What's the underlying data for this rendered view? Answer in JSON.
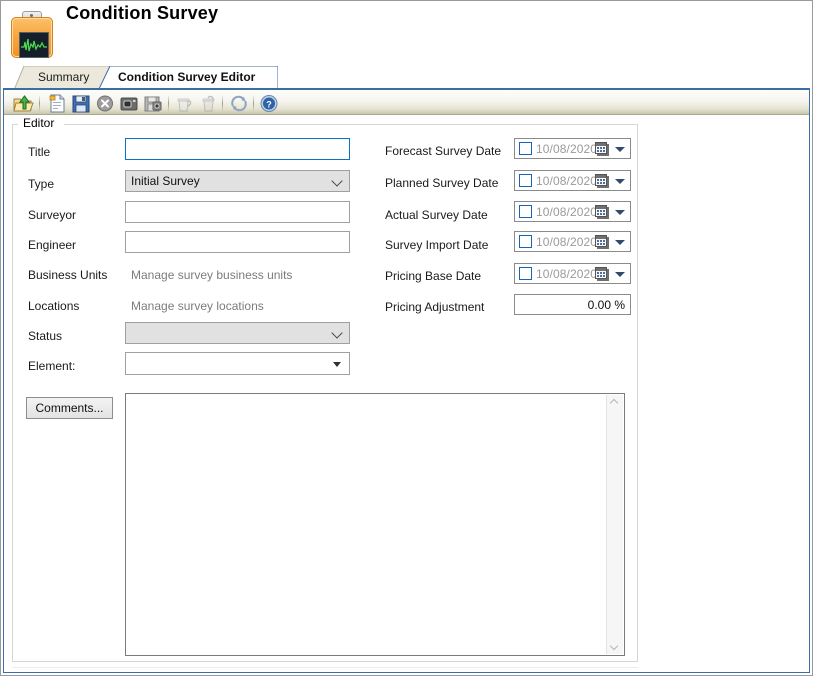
{
  "window": {
    "title": "Condition Survey",
    "app_icon": "clipboard-waveform-icon"
  },
  "tabs": [
    {
      "label": "Summary",
      "active": false,
      "name": "tab-summary"
    },
    {
      "label": "Condition Survey Editor",
      "active": true,
      "name": "tab-condition-survey-editor"
    }
  ],
  "toolbar": {
    "buttons": [
      {
        "name": "open-folder-icon",
        "title": "Open",
        "enabled": true
      },
      {
        "name": "new-document-icon",
        "title": "New",
        "enabled": true
      },
      {
        "name": "save-icon",
        "title": "Save",
        "enabled": true
      },
      {
        "name": "cancel-icon",
        "title": "Cancel",
        "enabled": true
      },
      {
        "name": "snapshot-icon",
        "title": "Snapshot",
        "enabled": true
      },
      {
        "name": "save-image-icon",
        "title": "Save Image",
        "enabled": true
      },
      {
        "name": "delete-record-icon",
        "title": "Delete",
        "enabled": false
      },
      {
        "name": "delete-item-icon",
        "title": "Remove",
        "enabled": false
      },
      {
        "name": "refresh-icon",
        "title": "Refresh",
        "enabled": true
      },
      {
        "name": "help-icon",
        "title": "Help",
        "enabled": true
      }
    ]
  },
  "editor": {
    "group_label": "Editor",
    "left_fields": {
      "title": {
        "label": "Title",
        "value": "",
        "placeholder": ""
      },
      "type": {
        "label": "Type",
        "value": "Initial Survey",
        "options": [
          "Initial Survey"
        ]
      },
      "surveyor": {
        "label": "Surveyor",
        "value": "",
        "placeholder": ""
      },
      "engineer": {
        "label": "Engineer",
        "value": "",
        "placeholder": ""
      },
      "business_units": {
        "label": "Business Units",
        "link_text": "Manage survey business units"
      },
      "locations": {
        "label": "Locations",
        "link_text": "Manage survey locations"
      },
      "status": {
        "label": "Status",
        "value": "",
        "options": []
      },
      "element": {
        "label": "Element:",
        "value": "",
        "options": []
      }
    },
    "right_fields": {
      "forecast_survey_date": {
        "label": "Forecast Survey Date",
        "value": "10/08/2020",
        "checked": false
      },
      "planned_survey_date": {
        "label": "Planned Survey Date",
        "value": "10/08/2020",
        "checked": false
      },
      "actual_survey_date": {
        "label": "Actual Survey Date",
        "value": "10/08/2020",
        "checked": false
      },
      "survey_import_date": {
        "label": "Survey Import Date",
        "value": "10/08/2020",
        "checked": false
      },
      "pricing_base_date": {
        "label": "Pricing Base Date",
        "value": "10/08/2020",
        "checked": false
      },
      "pricing_adjustment": {
        "label": "Pricing Adjustment",
        "value": "0.00 %"
      }
    },
    "comments": {
      "button_label": "Comments...",
      "text": "",
      "scroll_up_icon": "chevron-up-icon",
      "scroll_down_icon": "chevron-down-icon"
    }
  },
  "colors": {
    "accent_blue": "#3b6ea5",
    "focus_blue": "#0a72c4",
    "toolbar_bottom": "#c9c7ae",
    "tab_inactive": "#ece9dc",
    "disabled_text": "#7c7c7c"
  }
}
